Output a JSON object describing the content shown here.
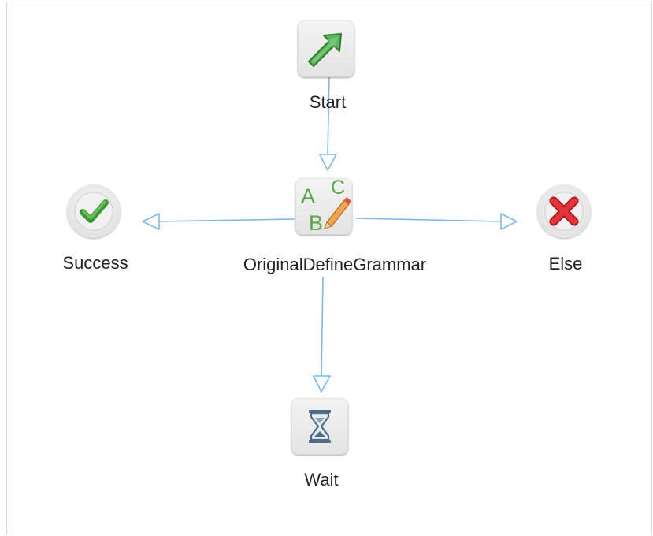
{
  "diagram": {
    "nodes": {
      "start": {
        "label": "Start",
        "icon": "arrow-up-right-icon"
      },
      "grammar": {
        "label": "OriginalDefineGrammar",
        "icon": "abc-pencil-icon"
      },
      "success": {
        "label": "Success",
        "icon": "checkmark-icon"
      },
      "else": {
        "label": "Else",
        "icon": "red-x-icon"
      },
      "wait": {
        "label": "Wait",
        "icon": "hourglass-icon"
      }
    },
    "edges": [
      {
        "from": "start",
        "to": "grammar"
      },
      {
        "from": "grammar",
        "to": "success"
      },
      {
        "from": "grammar",
        "to": "else"
      },
      {
        "from": "grammar",
        "to": "wait"
      }
    ],
    "colors": {
      "edge": "#7cb8ec",
      "start_arrow": "#4da64d",
      "success_check": "#3a9a32",
      "else_x": "#d8232a",
      "wait_hourglass": "#4f6b88"
    }
  }
}
